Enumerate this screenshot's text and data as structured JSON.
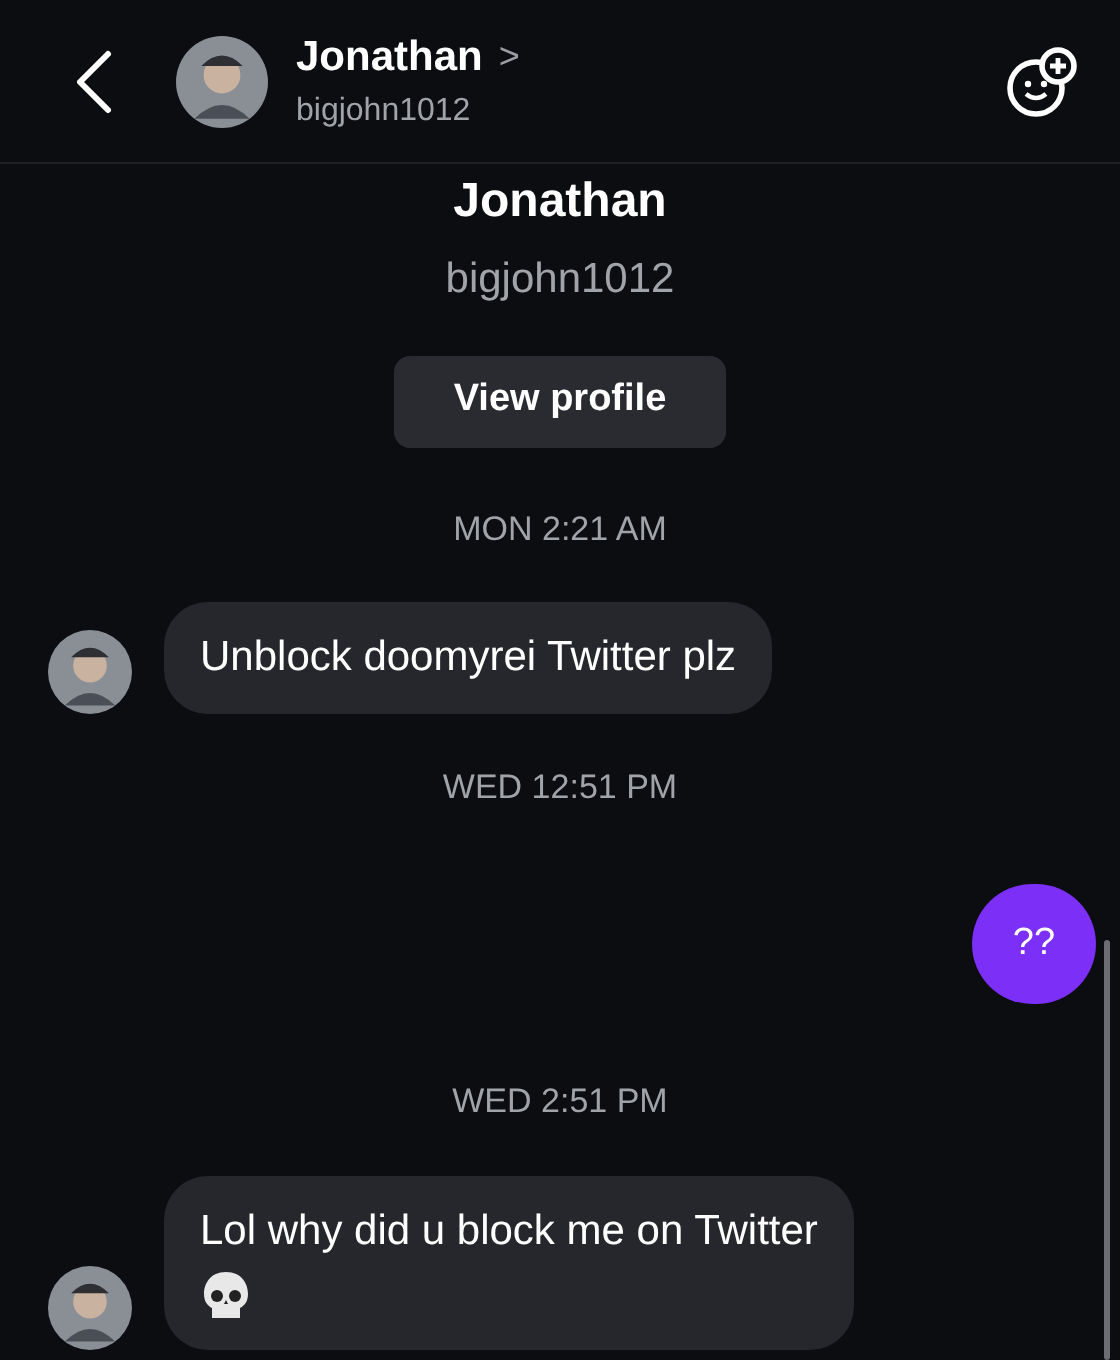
{
  "header": {
    "name": "Jonathan",
    "chevron": ">",
    "username": "bigjohn1012"
  },
  "profile": {
    "name": "Jonathan",
    "username": "bigjohn1012",
    "button": "View profile"
  },
  "thread": [
    {
      "kind": "timestamp",
      "text": "MON 2:21 AM"
    },
    {
      "kind": "incoming",
      "text": "Unblock doomyrei Twitter plz",
      "skull": false
    },
    {
      "kind": "timestamp",
      "text": "WED 12:51 PM"
    },
    {
      "kind": "outgoing",
      "text": "??"
    },
    {
      "kind": "timestamp",
      "text": "WED 2:51 PM"
    },
    {
      "kind": "incoming",
      "text": "Lol why did u block me on Twitter",
      "skull": true
    }
  ]
}
